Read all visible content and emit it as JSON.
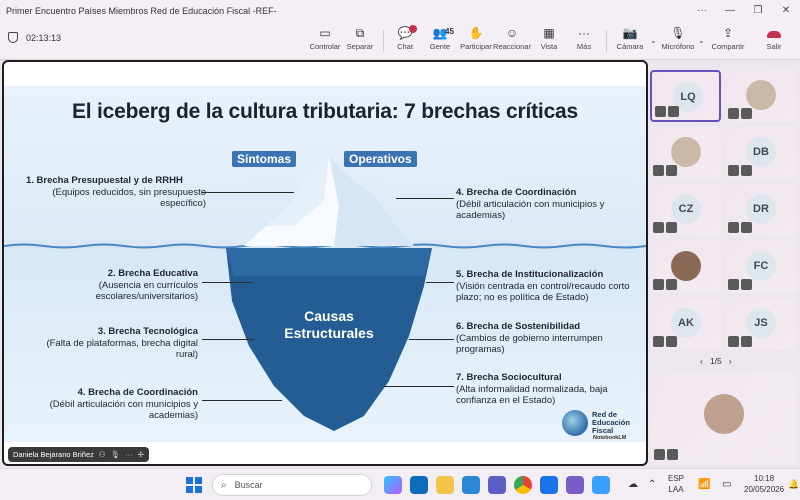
{
  "window": {
    "title": "Primer Encuentro Países Miembros Red de Educación Fiscal -REF-"
  },
  "meeting": {
    "timer": "02:13:13"
  },
  "toolbar": {
    "controlar": "Controlar",
    "separar": "Separar",
    "chat": "Chat",
    "gente": "Gente",
    "gente_count": "45",
    "participar": "Participar",
    "reaccionar": "Reaccionar",
    "vista": "Vista",
    "mas": "Más",
    "camara": "Cámara",
    "microfono": "Micrófono",
    "compartir": "Compartir",
    "salir": "Salir"
  },
  "slide": {
    "title": "El iceberg de la cultura tributaria: 7 brechas críticas",
    "tag_sintomas": "Síntomas",
    "tag_operativos": "Operativos",
    "causas": "Causas Estructurales",
    "left_items": [
      {
        "title": "1. Brecha Presupuestal y de RRHH",
        "desc": "(Equipos reducidos, sin presupuesto específico)"
      },
      {
        "title": "2. Brecha Educativa",
        "desc": "(Ausencia en currículos escolares/universitarios)"
      },
      {
        "title": "3. Brecha Tecnológica",
        "desc": "(Falta de plataformas, brecha digital rural)"
      },
      {
        "title": "4. Brecha de Coordinación",
        "desc": "(Débil articulación con municipios y academias)"
      }
    ],
    "right_items": [
      {
        "title": "4. Brecha de Coordinación",
        "desc": "(Débil articulación con municipios y academias)"
      },
      {
        "title": "5. Brecha de Institucionalización",
        "desc": "(Visión centrada en control/recaudo corto plazo; no es política de Estado)"
      },
      {
        "title": "6. Brecha de Sostenibilidad",
        "desc": "(Cambios de gobierno interrumpen programas)"
      },
      {
        "title": "7. Brecha Sociocultural",
        "desc": "(Alta informalidad normalizada, baja confianza en el Estado)"
      }
    ],
    "logo_line1": "Red de",
    "logo_line2": "Educación",
    "logo_line3": "Fiscal",
    "notebooklm": "NotebookLM"
  },
  "presenter": {
    "name": "Daniela Bejarano Briñez"
  },
  "participants": [
    {
      "initials": "LQ",
      "selected": true
    },
    {
      "initials": "",
      "photo": true
    },
    {
      "initials": "",
      "photo": true
    },
    {
      "initials": "DB"
    },
    {
      "initials": "CZ"
    },
    {
      "initials": "DR"
    },
    {
      "initials": "",
      "photo": true
    },
    {
      "initials": "FC"
    },
    {
      "initials": "AK"
    },
    {
      "initials": "JS"
    }
  ],
  "pager": {
    "label": "1/5"
  },
  "taskbar": {
    "search_placeholder": "Buscar",
    "lang_line1": "ESP",
    "lang_line2": "LAA",
    "time": "10:18",
    "date": "20/05/2026"
  },
  "colors": {
    "accent": "#6b4fbb",
    "leave": "#c4314b",
    "slide_tag": "#3c74b3",
    "iceberg_deep": "#235d93"
  }
}
